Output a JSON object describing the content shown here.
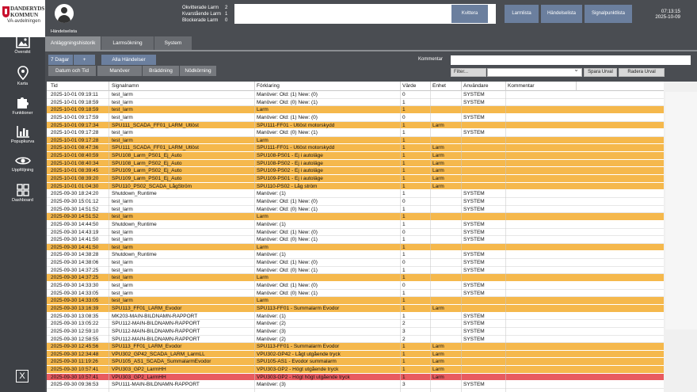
{
  "brand": {
    "name_line1": "DANDERYDS",
    "name_line2": "KOMMUN",
    "department": "VA-avdelningen"
  },
  "sidebar": {
    "items": [
      {
        "label": "Översikt",
        "icon": "image-icon"
      },
      {
        "label": "Karta",
        "icon": "map-pin-icon"
      },
      {
        "label": "Funktioner",
        "icon": "puzzle-icon"
      },
      {
        "label": "Popupkurva",
        "icon": "bar-chart-icon"
      },
      {
        "label": "Uppföljning",
        "icon": "eye-icon"
      },
      {
        "label": "Dashboard",
        "icon": "grid-icon"
      }
    ],
    "close_label": "X"
  },
  "header": {
    "counts": [
      {
        "label": "Okvitterade Larm",
        "value": "2"
      },
      {
        "label": "Kvarstående Larm",
        "value": "1"
      },
      {
        "label": "Blockerade Larm",
        "value": "0"
      }
    ],
    "kvittera_label": "Kvittera",
    "nav_buttons": [
      "Larmlista",
      "Händelselista",
      "Signalpunktlista"
    ],
    "time": "07:13:15",
    "date": "2025-10-09"
  },
  "page": {
    "subtitle": "Händelselista",
    "tabs": [
      "Anläggningshistorik",
      "Larmsökning",
      "System"
    ],
    "active_tab": "Anläggningshistorik"
  },
  "toolbar": {
    "days": "7 Dagar",
    "plus": "+",
    "alla": "Alla Händelser",
    "datum": "Datum och Tid",
    "manover": "Manöver",
    "braddning": "Bräddning",
    "nodkorning": "Nödkörning",
    "kommentar_label": "Kommentar",
    "filter_label": "Filter...",
    "spara": "Spara Urval",
    "radera": "Radera Urval"
  },
  "table": {
    "columns": [
      "Tid",
      "Signalnamn",
      "Förklaring",
      "Värde",
      "Enhet",
      "Användare",
      "Kommentar"
    ],
    "rows": [
      {
        "tid": "2025-10-01 09:19:11",
        "sig": "test_larm",
        "for": "Manöver: Old: (1)  New: (0)",
        "var": "0",
        "enh": "",
        "anv": "SYSTEM",
        "color": "white"
      },
      {
        "tid": "2025-10-01 09:18:59",
        "sig": "test_larm",
        "for": "Manöver: Old: (0)  New: (1)",
        "var": "1",
        "enh": "",
        "anv": "SYSTEM",
        "color": "white"
      },
      {
        "tid": "2025-10-01 09:18:59",
        "sig": "test_larm",
        "for": "Larm",
        "var": "1",
        "enh": "",
        "anv": "",
        "color": "orange"
      },
      {
        "tid": "2025-10-01 09:17:59",
        "sig": "test_larm",
        "for": "Manöver: Old: (1)  New: (0)",
        "var": "0",
        "enh": "",
        "anv": "SYSTEM",
        "color": "white"
      },
      {
        "tid": "2025-10-01 09:17:34",
        "sig": "SPU111_SCADA_FF01_LARM_Utlöst",
        "for": "SPU111-FF01 - Utlöst motorskydd",
        "var": "1",
        "enh": "Larm",
        "anv": "",
        "color": "orange"
      },
      {
        "tid": "2025-10-01 09:17:28",
        "sig": "test_larm",
        "for": "Manöver: Old: (0)  New: (1)",
        "var": "1",
        "enh": "",
        "anv": "SYSTEM",
        "color": "white"
      },
      {
        "tid": "2025-10-01 09:17:28",
        "sig": "test_larm",
        "for": "Larm",
        "var": "1",
        "enh": "",
        "anv": "",
        "color": "orange"
      },
      {
        "tid": "2025-10-01 08:47:36",
        "sig": "SPU111_SCADA_FF01_LARM_Utlöst",
        "for": "SPU111-FF01 - Utlöst motorskydd",
        "var": "1",
        "enh": "Larm",
        "anv": "",
        "color": "orange"
      },
      {
        "tid": "2025-10-01 08:40:59",
        "sig": "SPU108_Larm_PS01_Ej_Auto",
        "for": "SPU108-PS01 - Ej i autoläge",
        "var": "1",
        "enh": "Larm",
        "anv": "",
        "color": "orange"
      },
      {
        "tid": "2025-10-01 08:40:34",
        "sig": "SPU108_Larm_PS02_Ej_Auto",
        "for": "SPU108-PS02 - Ej i autoläge",
        "var": "1",
        "enh": "Larm",
        "anv": "",
        "color": "orange"
      },
      {
        "tid": "2025-10-01 08:39:45",
        "sig": "SPU109_Larm_PS02_Ej_Auto",
        "for": "SPU109-PS02 - Ej i autoläge",
        "var": "1",
        "enh": "Larm",
        "anv": "",
        "color": "orange"
      },
      {
        "tid": "2025-10-01 08:39:20",
        "sig": "SPU109_Larm_PS01_Ej_Auto",
        "for": "SPU109-PS01 - Ej i autoläge",
        "var": "1",
        "enh": "Larm",
        "anv": "",
        "color": "orange"
      },
      {
        "tid": "2025-10-01 01:04:30",
        "sig": "SPU110_PS02_SCADA_LågStröm",
        "for": "SPU110-PS02 - Låg ström",
        "var": "1",
        "enh": "Larm",
        "anv": "",
        "color": "orange"
      },
      {
        "tid": "2025-09-30 18:24:20",
        "sig": "Shutdown_Runtime",
        "for": "Manöver: (1)",
        "var": "1",
        "enh": "",
        "anv": "SYSTEM",
        "color": "white"
      },
      {
        "tid": "2025-09-30 15:01:12",
        "sig": "test_larm",
        "for": "Manöver: Old: (1)  New: (0)",
        "var": "0",
        "enh": "",
        "anv": "SYSTEM",
        "color": "white"
      },
      {
        "tid": "2025-09-30 14:51:52",
        "sig": "test_larm",
        "for": "Manöver: Old: (0)  New: (1)",
        "var": "1",
        "enh": "",
        "anv": "SYSTEM",
        "color": "white"
      },
      {
        "tid": "2025-09-30 14:51:52",
        "sig": "test_larm",
        "for": "Larm",
        "var": "1",
        "enh": "",
        "anv": "",
        "color": "orange"
      },
      {
        "tid": "2025-09-30 14:44:50",
        "sig": "Shutdown_Runtime",
        "for": "Manöver: (1)",
        "var": "1",
        "enh": "",
        "anv": "SYSTEM",
        "color": "white"
      },
      {
        "tid": "2025-09-30 14:43:19",
        "sig": "test_larm",
        "for": "Manöver: Old: (1)  New: (0)",
        "var": "0",
        "enh": "",
        "anv": "SYSTEM",
        "color": "white"
      },
      {
        "tid": "2025-09-30 14:41:50",
        "sig": "test_larm",
        "for": "Manöver: Old: (0)  New: (1)",
        "var": "1",
        "enh": "",
        "anv": "SYSTEM",
        "color": "white"
      },
      {
        "tid": "2025-09-30 14:41:50",
        "sig": "test_larm",
        "for": "Larm",
        "var": "1",
        "enh": "",
        "anv": "",
        "color": "orange"
      },
      {
        "tid": "2025-09-30 14:38:28",
        "sig": "Shutdown_Runtime",
        "for": "Manöver: (1)",
        "var": "1",
        "enh": "",
        "anv": "SYSTEM",
        "color": "white"
      },
      {
        "tid": "2025-09-30 14:38:06",
        "sig": "test_larm",
        "for": "Manöver: Old: (1)  New: (0)",
        "var": "0",
        "enh": "",
        "anv": "SYSTEM",
        "color": "white"
      },
      {
        "tid": "2025-09-30 14:37:25",
        "sig": "test_larm",
        "for": "Manöver: Old: (0)  New: (1)",
        "var": "1",
        "enh": "",
        "anv": "SYSTEM",
        "color": "white"
      },
      {
        "tid": "2025-09-30 14:37:25",
        "sig": "test_larm",
        "for": "Larm",
        "var": "1",
        "enh": "",
        "anv": "",
        "color": "orange"
      },
      {
        "tid": "2025-09-30 14:33:30",
        "sig": "test_larm",
        "for": "Manöver: Old: (1)  New: (0)",
        "var": "0",
        "enh": "",
        "anv": "SYSTEM",
        "color": "white"
      },
      {
        "tid": "2025-09-30 14:33:05",
        "sig": "test_larm",
        "for": "Manöver: Old: (0)  New: (1)",
        "var": "1",
        "enh": "",
        "anv": "SYSTEM",
        "color": "white"
      },
      {
        "tid": "2025-09-30 14:33:05",
        "sig": "test_larm",
        "for": "Larm",
        "var": "1",
        "enh": "",
        "anv": "",
        "color": "orange"
      },
      {
        "tid": "2025-09-30 13:16:39",
        "sig": "SPU113_FF01_LARM_Evodor",
        "for": "SPU113-FF01 - Summalarm Evodor",
        "var": "1",
        "enh": "Larm",
        "anv": "",
        "color": "orange"
      },
      {
        "tid": "2025-09-30 13:08:35",
        "sig": "MK203-MAIN-BILDNAMN-RAPPORT",
        "for": "Manöver: (1)",
        "var": "1",
        "enh": "",
        "anv": "SYSTEM",
        "color": "white"
      },
      {
        "tid": "2025-09-30 13:05:22",
        "sig": "SPU112-MAIN-BILDNAMN-RAPPORT",
        "for": "Manöver: (2)",
        "var": "2",
        "enh": "",
        "anv": "SYSTEM",
        "color": "white"
      },
      {
        "tid": "2025-09-30 12:59:10",
        "sig": "SPU112-MAIN-BILDNAMN-RAPPORT",
        "for": "Manöver: (3)",
        "var": "3",
        "enh": "",
        "anv": "SYSTEM",
        "color": "white"
      },
      {
        "tid": "2025-09-30 12:58:55",
        "sig": "SPU112-MAIN-BILDNAMN-RAPPORT",
        "for": "Manöver: (2)",
        "var": "2",
        "enh": "",
        "anv": "SYSTEM",
        "color": "white"
      },
      {
        "tid": "2025-09-30 12:45:56",
        "sig": "SPU113_FF01_LARM_Evodor",
        "for": "SPU113-FF01 - Summalarm Evodor",
        "var": "1",
        "enh": "Larm",
        "anv": "",
        "color": "orange"
      },
      {
        "tid": "2025-09-30 12:34:48",
        "sig": "VPU302_GP42_SCADA_LARM_LarmLL",
        "for": "VPU302-GP42 - Lågt utgående tryck",
        "var": "1",
        "enh": "Larm",
        "anv": "",
        "color": "orange"
      },
      {
        "tid": "2025-09-30 11:19:26",
        "sig": "SPU105_AS1_SCADA_SummalarmEvodor",
        "for": "SPU105-AS1 - Evodor summalarm",
        "var": "1",
        "enh": "Larm",
        "anv": "",
        "color": "orange"
      },
      {
        "tid": "2025-09-30 10:57:41",
        "sig": "VPU303_GP2_LarmHH",
        "for": "VPU303-GP2 - Högt utgående tryck",
        "var": "1",
        "enh": "Larm",
        "anv": "",
        "color": "orange"
      },
      {
        "tid": "2025-09-30 10:57:41",
        "sig": "VPU303_GP2_LarmHH",
        "for": "VPU303-GP2 - Högt högt utgående tryck",
        "var": "1",
        "enh": "Larm",
        "anv": "",
        "color": "red"
      },
      {
        "tid": "2025-09-30 09:36:53",
        "sig": "SPU111-MAIN-BILDNAMN-RAPPORT",
        "for": "Manöver: (3)",
        "var": "3",
        "enh": "",
        "anv": "SYSTEM",
        "color": "white"
      }
    ]
  },
  "colors": {
    "alarm": "#f5b84c",
    "critical": "#e85b60",
    "accent": "#6b7f9e",
    "background": "#4a4d52"
  }
}
